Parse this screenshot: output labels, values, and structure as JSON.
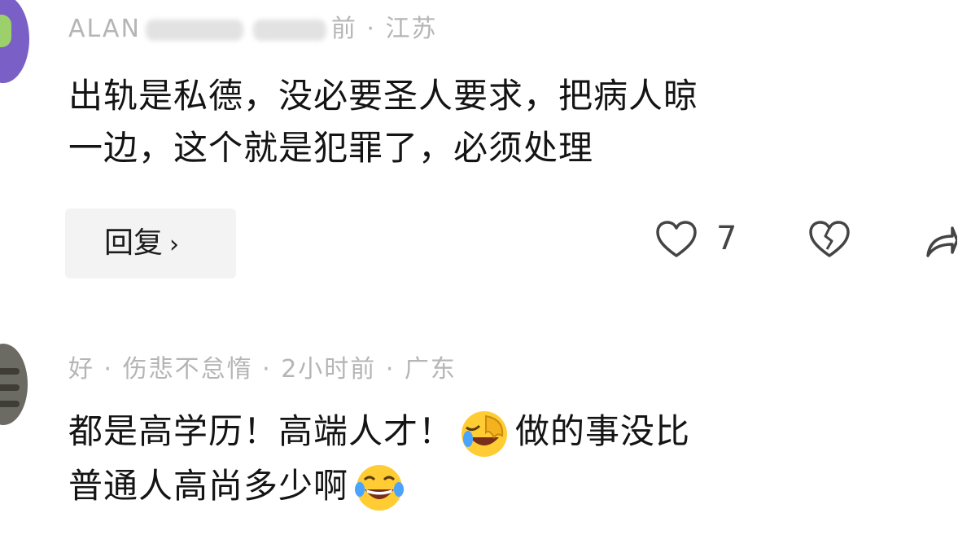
{
  "comments": [
    {
      "username": "ALAN",
      "meta_visible": "前 · 江苏",
      "text_line1": "出轨是私德，没必要圣人要求，把病人晾",
      "text_line2": "一边，这个就是犯罪了，必须处理",
      "reply_label": "回复",
      "like_count": "7"
    },
    {
      "meta_visible": "好 · 伤悲不怠惰 · 2小时前 · 广东",
      "text_line1_a": "都是高学历！高端人才！",
      "text_line1_b": "做的事没比",
      "text_line2": "普通人高尚多少啊"
    }
  ],
  "icons": {
    "reply_chevron": "›",
    "like": "heart-outline-icon",
    "dislike": "broken-heart-icon",
    "share": "share-arrow-icon",
    "emoji_1": "face-palm-laugh-emoji",
    "emoji_2": "laughing-tears-emoji"
  }
}
